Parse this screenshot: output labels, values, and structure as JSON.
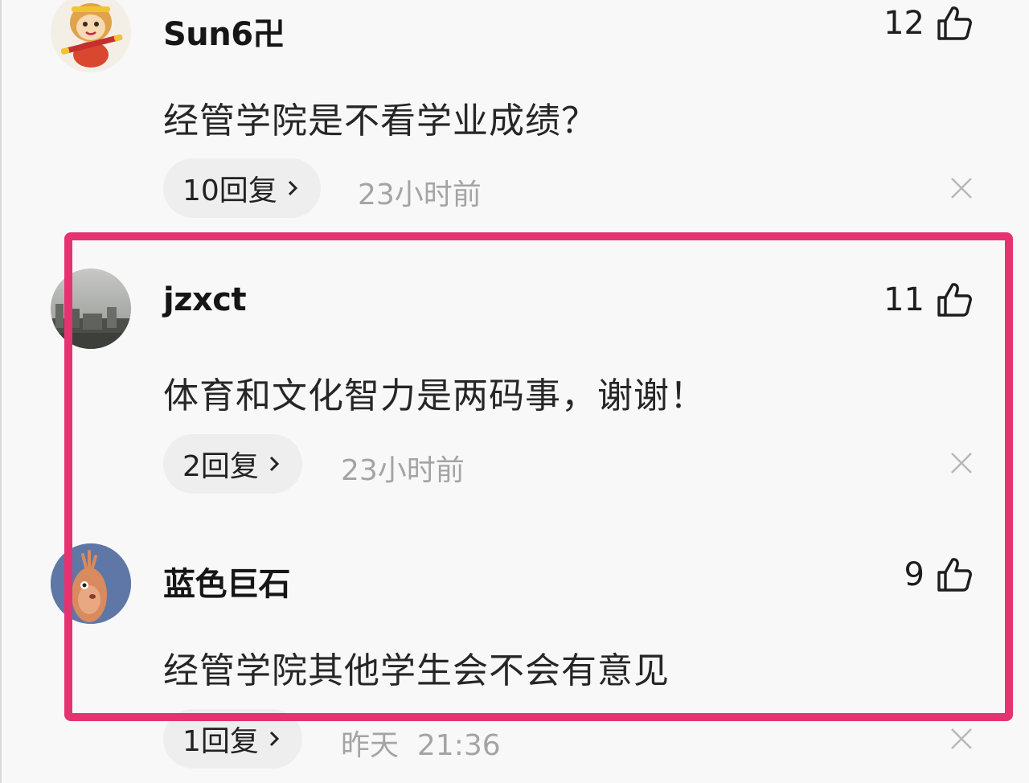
{
  "comments": [
    {
      "username": "Sun6卍",
      "likes": "12",
      "text": "经管学院是不看学业成绩？",
      "replies": "10回复",
      "time": "23小时前",
      "avatar": "monkey-king-cartoon"
    },
    {
      "username": "jzxct",
      "likes": "11",
      "text": "体育和文化智力是两码事，谢谢！",
      "replies": "2回复",
      "time": "23小时前",
      "avatar": "foggy-city-photo"
    },
    {
      "username": "蓝色巨石",
      "likes": "9",
      "text": "经管学院其他学生会不会有意见",
      "replies": "1回复",
      "time": "昨天  21:36",
      "avatar": "cartoon-deer"
    }
  ],
  "icons": {
    "like": "thumbs-up-icon",
    "close": "close-icon",
    "chevron": "chevron-right-icon"
  },
  "colors": {
    "highlight_border": "#e53372",
    "reply_pill_bg": "#eeeeee",
    "time_text": "#a4a4a4"
  }
}
